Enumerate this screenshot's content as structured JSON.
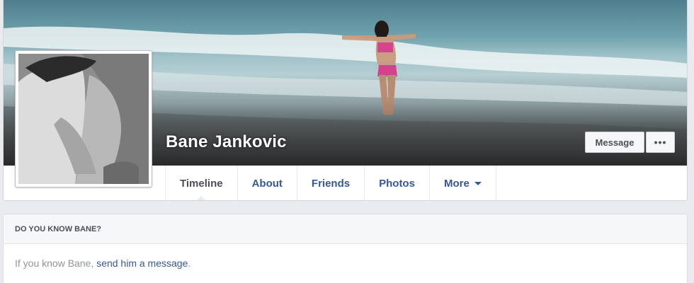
{
  "profile": {
    "name": "Bane Jankovic",
    "actions": {
      "message_label": "Message",
      "more_label": "•••"
    }
  },
  "nav": {
    "tabs": [
      {
        "label": "Timeline",
        "active": true
      },
      {
        "label": "About"
      },
      {
        "label": "Friends"
      },
      {
        "label": "Photos"
      },
      {
        "label": "More",
        "has_caret": true
      }
    ]
  },
  "know_card": {
    "title": "DO YOU KNOW BANE?",
    "text_prefix": "If you know Bane, ",
    "link_text": "send him a message",
    "text_suffix": "."
  },
  "colors": {
    "link": "#365899",
    "page_bg": "#e9ebee",
    "muted_text": "#90949c"
  }
}
